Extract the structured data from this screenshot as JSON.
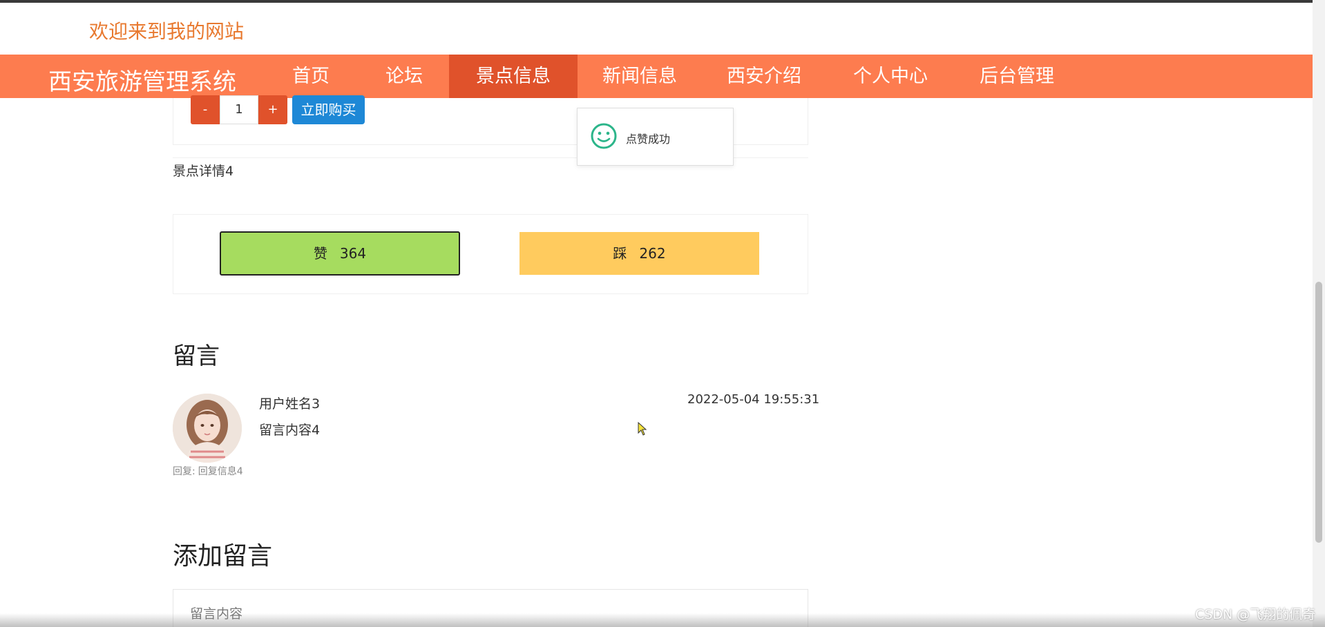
{
  "header": {
    "welcome": "欢迎来到我的网站"
  },
  "nav": {
    "brand": "西安旅游管理系统",
    "items": [
      {
        "label": "首页"
      },
      {
        "label": "论坛"
      },
      {
        "label": "景点信息",
        "active": true
      },
      {
        "label": "新闻信息"
      },
      {
        "label": "西安介绍"
      },
      {
        "label": "个人中心"
      },
      {
        "label": "后台管理"
      }
    ],
    "active_color": "#e0522b",
    "bar_color": "#fd7c4f"
  },
  "purchase": {
    "minus_label": "-",
    "quantity": "1",
    "plus_label": "+",
    "buy_label": "立即购买"
  },
  "detail": {
    "text": "景点详情4"
  },
  "vote": {
    "like_label": "赞",
    "like_count": "364",
    "dislike_label": "踩",
    "dislike_count": "262"
  },
  "toast": {
    "icon": "smile-icon",
    "text": "点赞成功"
  },
  "messages": {
    "title": "留言",
    "items": [
      {
        "user": "用户姓名3",
        "content": "留言内容4",
        "time": "2022-05-04 19:55:31",
        "reply_label": "回复:",
        "reply_text": "回复信息4"
      }
    ]
  },
  "add_message": {
    "title": "添加留言",
    "placeholder": "留言内容"
  },
  "watermark": "CSDN @飞翔的佩奇"
}
